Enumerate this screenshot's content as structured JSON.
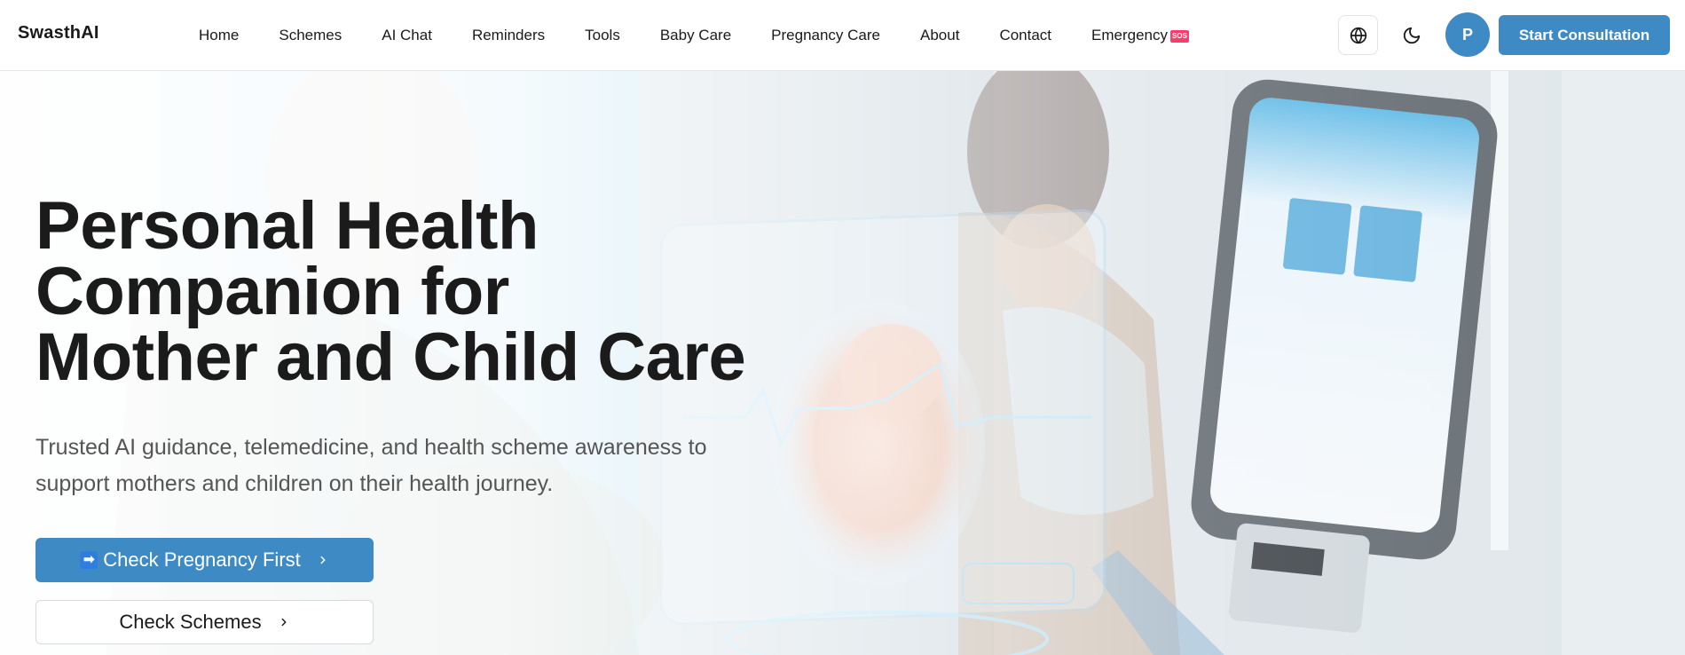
{
  "header": {
    "brand": "SwasthAI",
    "nav": [
      {
        "label": "Home"
      },
      {
        "label": "Schemes"
      },
      {
        "label": "AI Chat"
      },
      {
        "label": "Reminders"
      },
      {
        "label": "Tools"
      },
      {
        "label": "Baby Care"
      },
      {
        "label": "Pregnancy Care"
      },
      {
        "label": "About"
      },
      {
        "label": "Contact"
      },
      {
        "label": "Emergency",
        "badge": "SOS"
      }
    ],
    "language_icon": "globe-icon",
    "theme_icon": "moon-icon",
    "avatar_initial": "P",
    "cta_label": "Start Consultation"
  },
  "hero": {
    "title_line1": "Personal Health",
    "title_line2": "Companion for",
    "title_line3": "Mother and Child Care",
    "subtitle_line1": "Trusted AI guidance, telemedicine, and health scheme awareness to",
    "subtitle_line2": "support mothers and children on their health journey.",
    "primary_button": {
      "emoji": "➡",
      "label": "Check Pregnancy First",
      "icon": "chevron-right-icon"
    },
    "secondary_button": {
      "label": "Check Schemes",
      "icon": "chevron-right-icon"
    },
    "background_description_icon": "hero-image"
  },
  "colors": {
    "accent": "#3d8ac4",
    "sos_badge": "#ff3b6b",
    "text_dark": "#1b1b1b",
    "text_muted": "#555555"
  }
}
